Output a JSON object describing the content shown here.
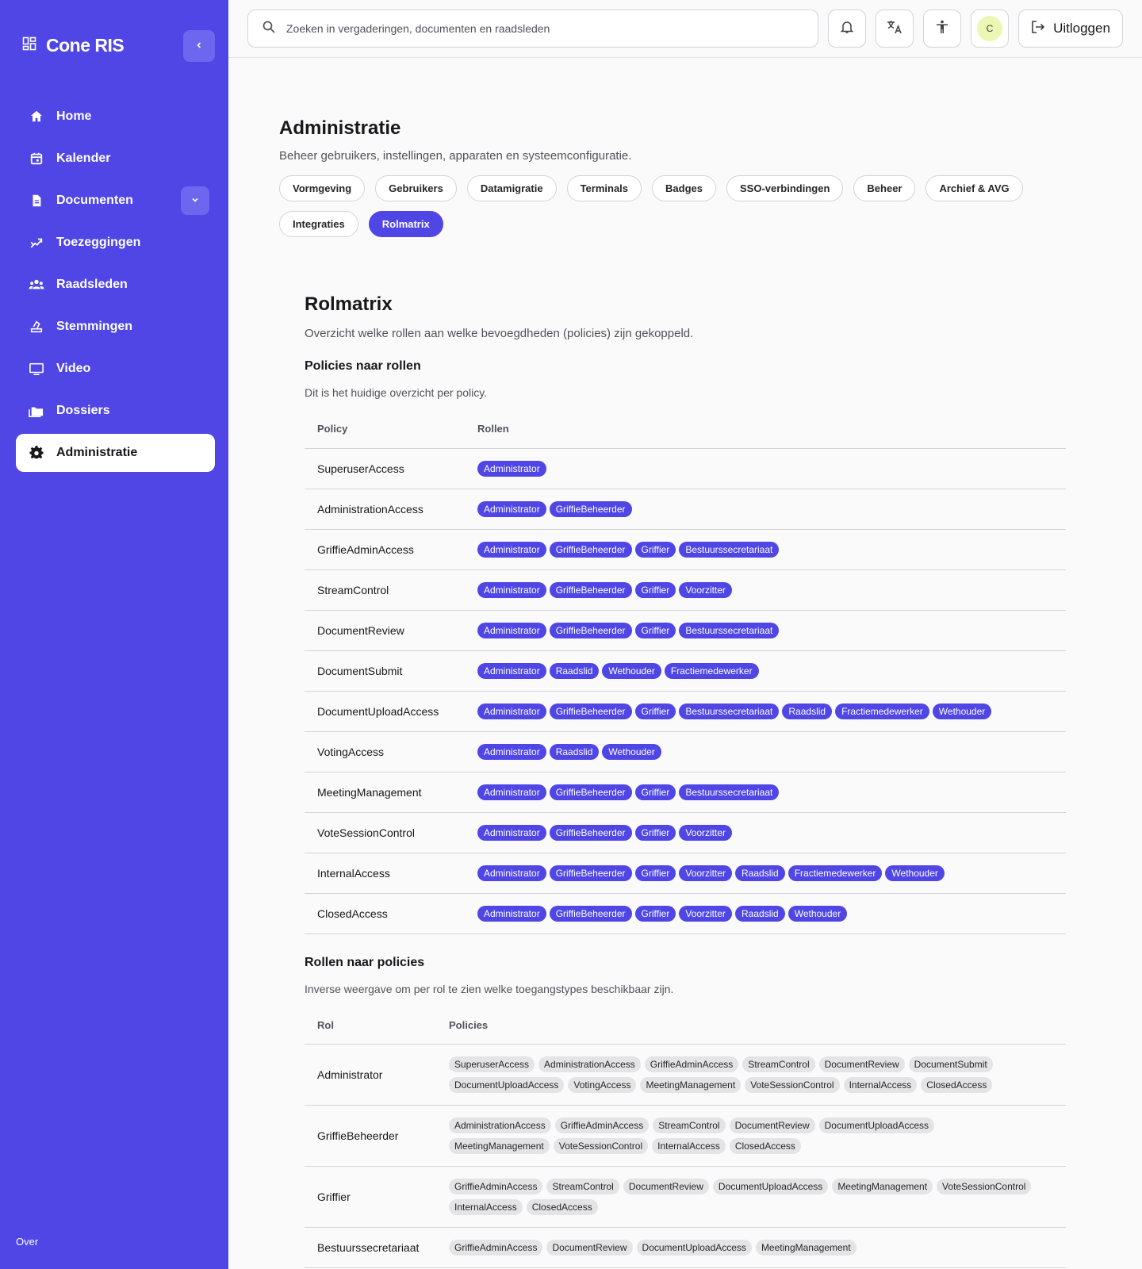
{
  "app": {
    "name": "Cone RIS"
  },
  "sidebar": {
    "items": [
      {
        "label": "Home",
        "icon": "home-icon"
      },
      {
        "label": "Kalender",
        "icon": "calendar-icon"
      },
      {
        "label": "Documenten",
        "icon": "document-icon"
      },
      {
        "label": "Toezeggingen",
        "icon": "handshake-icon"
      },
      {
        "label": "Raadsleden",
        "icon": "people-icon"
      },
      {
        "label": "Stemmingen",
        "icon": "ballot-icon"
      },
      {
        "label": "Video",
        "icon": "monitor-icon"
      },
      {
        "label": "Dossiers",
        "icon": "folder-icon"
      },
      {
        "label": "Administratie",
        "icon": "gear-icon",
        "active": true
      }
    ],
    "footer": "Over"
  },
  "topbar": {
    "search_placeholder": "Zoeken in vergaderingen, documenten en raadsleden",
    "avatar_initial": "C",
    "logout_label": "Uitloggen"
  },
  "page": {
    "title": "Administratie",
    "subtitle": "Beheer gebruikers, instellingen, apparaten en systeemconfiguratie.",
    "tabs": [
      "Vormgeving",
      "Gebruikers",
      "Datamigratie",
      "Terminals",
      "Badges",
      "SSO-verbindingen",
      "Beheer",
      "Archief & AVG",
      "Integraties",
      "Rolmatrix"
    ],
    "active_tab": "Rolmatrix"
  },
  "rolmatrix": {
    "title": "Rolmatrix",
    "subtitle": "Overzicht welke rollen aan welke bevoegdheden (policies) zijn gekoppeld.",
    "policies_section": {
      "title": "Policies naar rollen",
      "description": "Dit is het huidige overzicht per policy.",
      "col_policy": "Policy",
      "col_roles": "Rollen",
      "rows": [
        {
          "policy": "SuperuserAccess",
          "roles": [
            "Administrator"
          ]
        },
        {
          "policy": "AdministrationAccess",
          "roles": [
            "Administrator",
            "GriffieBeheerder"
          ]
        },
        {
          "policy": "GriffieAdminAccess",
          "roles": [
            "Administrator",
            "GriffieBeheerder",
            "Griffier",
            "Bestuurssecretariaat"
          ]
        },
        {
          "policy": "StreamControl",
          "roles": [
            "Administrator",
            "GriffieBeheerder",
            "Griffier",
            "Voorzitter"
          ]
        },
        {
          "policy": "DocumentReview",
          "roles": [
            "Administrator",
            "GriffieBeheerder",
            "Griffier",
            "Bestuurssecretariaat"
          ]
        },
        {
          "policy": "DocumentSubmit",
          "roles": [
            "Administrator",
            "Raadslid",
            "Wethouder",
            "Fractiemedewerker"
          ]
        },
        {
          "policy": "DocumentUploadAccess",
          "roles": [
            "Administrator",
            "GriffieBeheerder",
            "Griffier",
            "Bestuurssecretariaat",
            "Raadslid",
            "Fractiemedewerker",
            "Wethouder"
          ]
        },
        {
          "policy": "VotingAccess",
          "roles": [
            "Administrator",
            "Raadslid",
            "Wethouder"
          ]
        },
        {
          "policy": "MeetingManagement",
          "roles": [
            "Administrator",
            "GriffieBeheerder",
            "Griffier",
            "Bestuurssecretariaat"
          ]
        },
        {
          "policy": "VoteSessionControl",
          "roles": [
            "Administrator",
            "GriffieBeheerder",
            "Griffier",
            "Voorzitter"
          ]
        },
        {
          "policy": "InternalAccess",
          "roles": [
            "Administrator",
            "GriffieBeheerder",
            "Griffier",
            "Voorzitter",
            "Raadslid",
            "Fractiemedewerker",
            "Wethouder"
          ]
        },
        {
          "policy": "ClosedAccess",
          "roles": [
            "Administrator",
            "GriffieBeheerder",
            "Griffier",
            "Voorzitter",
            "Raadslid",
            "Wethouder"
          ]
        }
      ]
    },
    "roles_section": {
      "title": "Rollen naar policies",
      "description": "Inverse weergave om per rol te zien welke toegangstypes beschikbaar zijn.",
      "col_role": "Rol",
      "col_policies": "Policies",
      "rows": [
        {
          "role": "Administrator",
          "policies": [
            "SuperuserAccess",
            "AdministrationAccess",
            "GriffieAdminAccess",
            "StreamControl",
            "DocumentReview",
            "DocumentSubmit",
            "DocumentUploadAccess",
            "VotingAccess",
            "MeetingManagement",
            "VoteSessionControl",
            "InternalAccess",
            "ClosedAccess"
          ]
        },
        {
          "role": "GriffieBeheerder",
          "policies": [
            "AdministrationAccess",
            "GriffieAdminAccess",
            "StreamControl",
            "DocumentReview",
            "DocumentUploadAccess",
            "MeetingManagement",
            "VoteSessionControl",
            "InternalAccess",
            "ClosedAccess"
          ]
        },
        {
          "role": "Griffier",
          "policies": [
            "GriffieAdminAccess",
            "StreamControl",
            "DocumentReview",
            "DocumentUploadAccess",
            "MeetingManagement",
            "VoteSessionControl",
            "InternalAccess",
            "ClosedAccess"
          ]
        },
        {
          "role": "Bestuurssecretariaat",
          "policies": [
            "GriffieAdminAccess",
            "DocumentReview",
            "DocumentUploadAccess",
            "MeetingManagement"
          ]
        }
      ]
    }
  },
  "colors": {
    "accent": "#4f46e5",
    "accent_light": "#6d66ee",
    "avatar_bg": "#ecf7b4"
  }
}
